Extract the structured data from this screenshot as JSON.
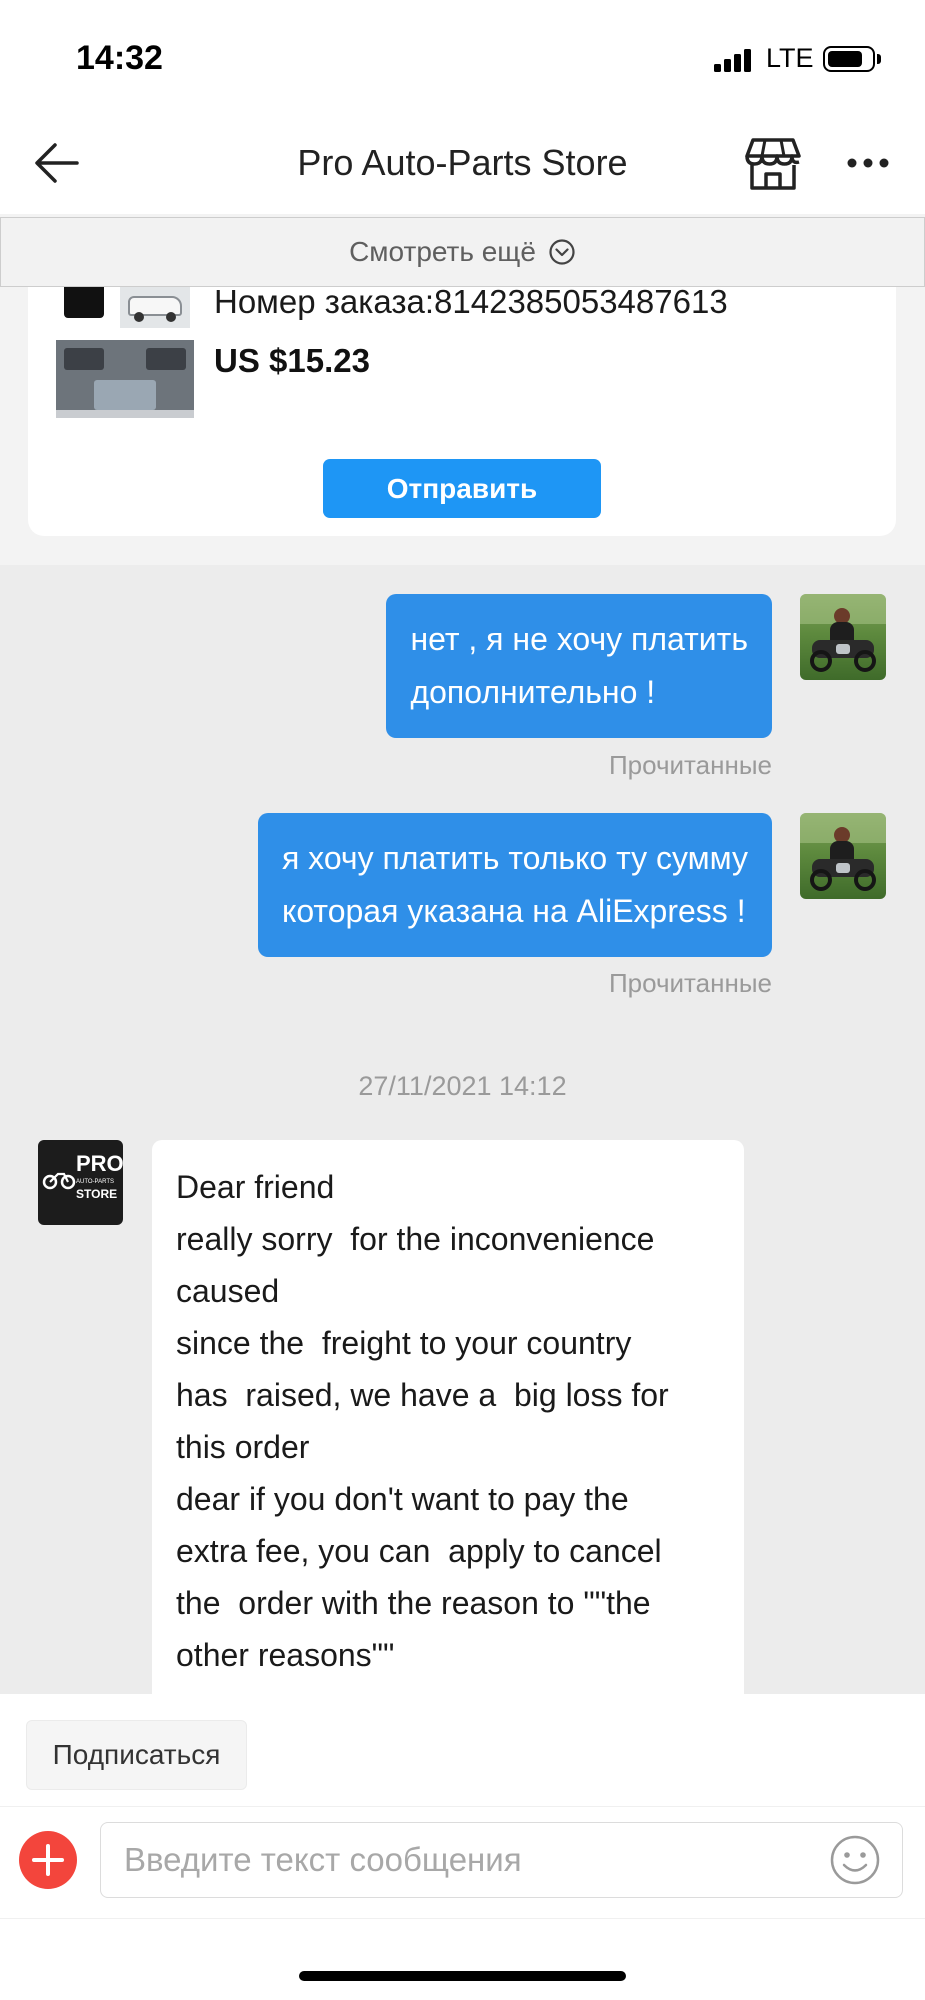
{
  "status_bar": {
    "time": "14:32",
    "network": "LTE",
    "icons": {
      "signal": "cellular-signal-icon",
      "battery": "battery-icon"
    }
  },
  "header": {
    "title": "Pro Auto-Parts Store",
    "icons": {
      "back": "arrow-left-icon",
      "store": "store-icon",
      "more": "more-horizontal-icon"
    }
  },
  "load_more": {
    "label": "Смотреть ещё",
    "icon": "chevron-down-circle-icon"
  },
  "order_card": {
    "order_number": "Номер заказа:8142385053487613",
    "price": "US $15.23",
    "send_button": "Отправить"
  },
  "chat": {
    "outgoing": [
      {
        "lines": [
          "нет , я не хочу платить",
          "дополнительно !"
        ],
        "status": "Прочитанные"
      },
      {
        "lines": [
          "я хочу платить только ту сумму",
          "которая указана на AliExpress !"
        ],
        "status": "Прочитанные"
      }
    ],
    "timestamp": "27/11/2021 14:12",
    "incoming": {
      "sender_logo": {
        "line1": "PRO",
        "line2": "AUTO-PARTS",
        "line3": "STORE"
      },
      "lines": [
        "Dear friend",
        "really sorry  for the inconvenience",
        "caused",
        "since the  freight to your country",
        "has  raised, we have a  big loss for",
        "this order",
        "dear if you don't want to pay the",
        "extra fee, you can  apply to cancel",
        "the  order with the reason to \"\"the",
        "other reasons\"\""
      ]
    }
  },
  "composer": {
    "subscribe_label": "Подписаться",
    "placeholder": "Введите текст сообщения",
    "icons": {
      "add": "plus-circle-icon",
      "emoji": "smiley-icon"
    }
  },
  "colors": {
    "outgoing_bubble": "#2f8fe8",
    "send_button": "#1e96f5",
    "add_button": "#f3453c",
    "chat_background": "#ececec",
    "muted_text": "#9a9a9a"
  }
}
